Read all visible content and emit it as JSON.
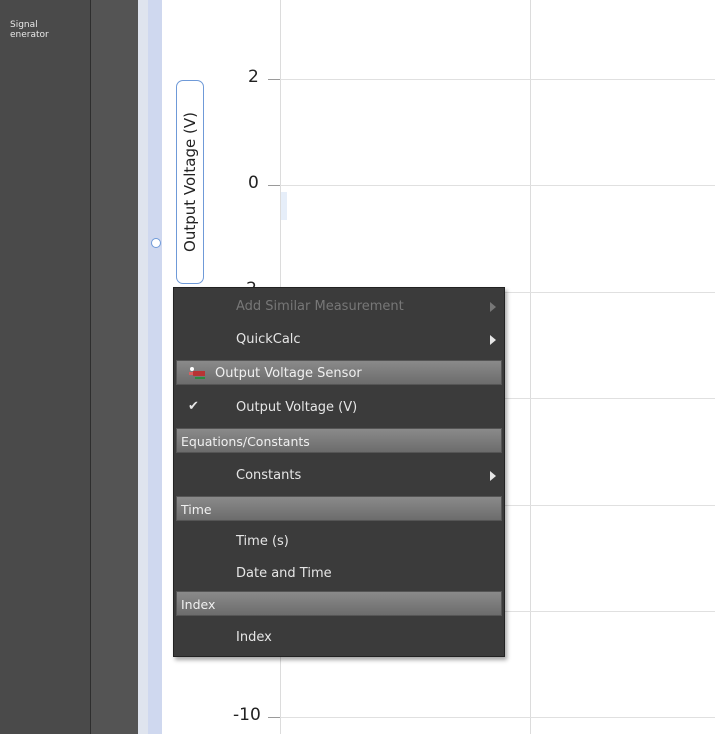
{
  "left_panel": {
    "label_line1": "Signal",
    "label_line2": "enerator"
  },
  "graph": {
    "y_axis_label": "Output Voltage (V)",
    "y_ticks": [
      "2",
      "0",
      "-2",
      "-10"
    ]
  },
  "context_menu": {
    "add_similar": "Add Similar Measurement",
    "quickcalc": "QuickCalc",
    "sensor_header": "Output Voltage Sensor",
    "output_voltage": "Output Voltage (V)",
    "equations_header": "Equations/Constants",
    "constants": "Constants",
    "time_header": "Time",
    "time_s": "Time (s)",
    "date_time": "Date and Time",
    "index_header": "Index",
    "index": "Index",
    "check_glyph": "✔"
  },
  "colors": {
    "axis_label_border": "#6f9ad8",
    "menu_bg": "#3b3b3b",
    "header_bg": "#7a7a7a"
  }
}
